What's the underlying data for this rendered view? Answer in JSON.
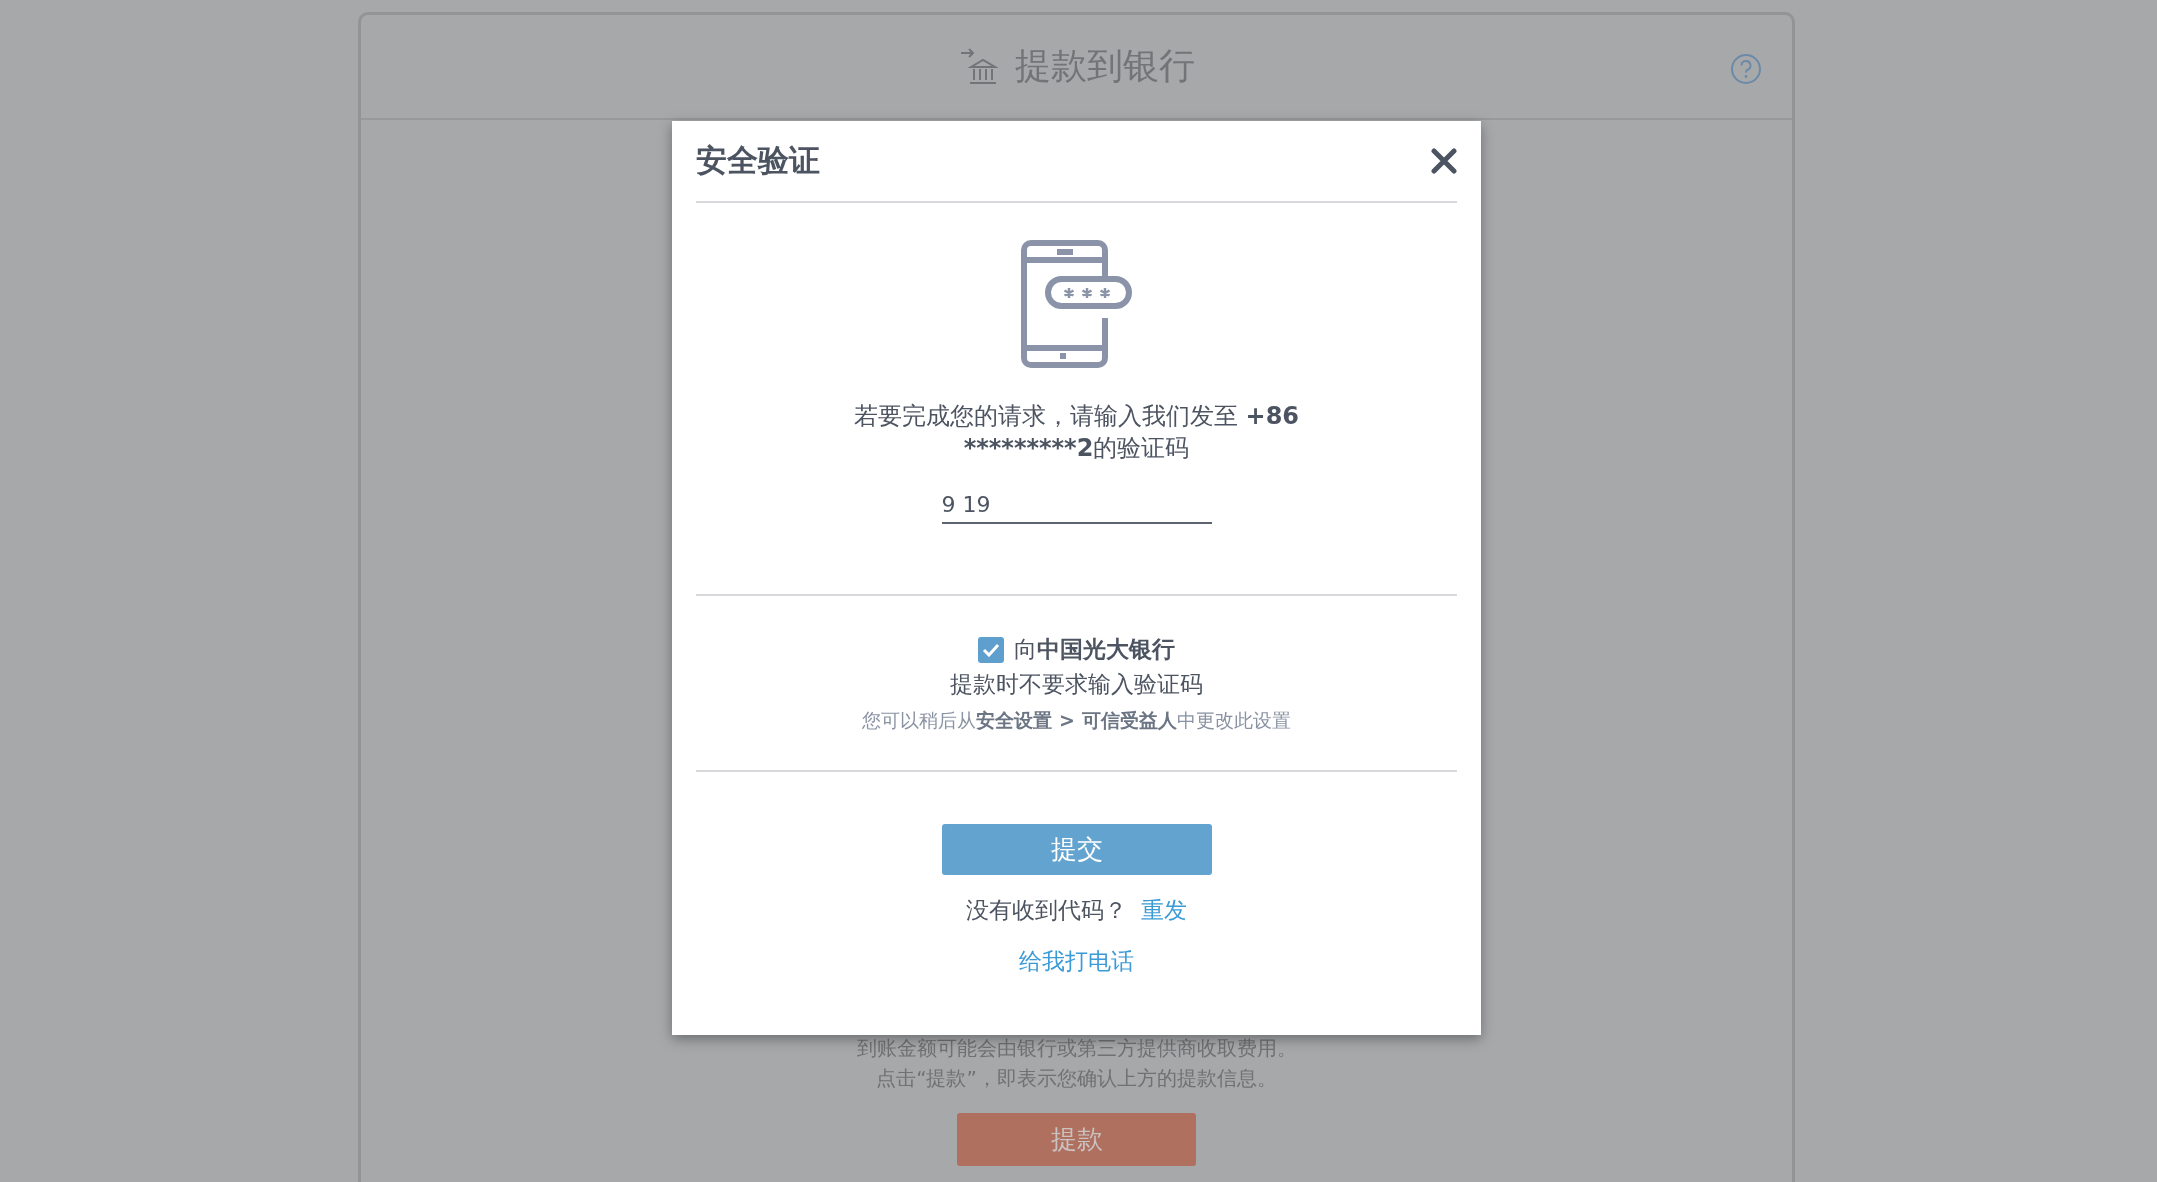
{
  "page": {
    "title": "提款到银行",
    "fee_note": "到账金额可能会由银行或第三方提供商收取费用。",
    "confirm_note": "点击“提款”，即表示您确认上方的提款信息。",
    "withdraw_button": "提款"
  },
  "dialog": {
    "title": "安全验证",
    "message": "若要完成您的请求，请输入我们发至 ",
    "phone": "+86 *********2",
    "message_end": "的验证码",
    "code_field": {
      "value": "9 19"
    },
    "trust": {
      "checked": true,
      "label": "向**中国光大银行**",
      "label_2": "提款时不要求输入验证码",
      "hint": "您可以稍后从**安全设置 > 可信受益人**中更改此设置"
    },
    "submit": "提交",
    "no_code": "没有收到代码？",
    "resend": "重发",
    "call": "给我打电话"
  }
}
